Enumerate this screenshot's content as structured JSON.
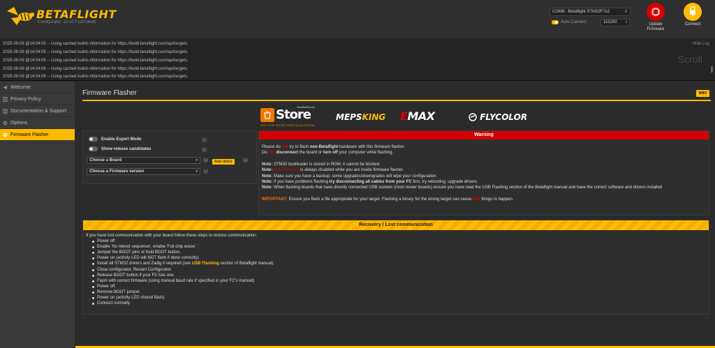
{
  "header": {
    "brand": "BETAFLIGHT",
    "version": "Configurator: 10.10.0 (c97deaf)",
    "port": "COM8 - Betaflight STM32F7x2",
    "auto_connect": "Auto-Connect",
    "baud": "115200",
    "update_firmware": "Update Firmware",
    "connect": "Connect",
    "colors": {
      "accent": "#ffbb00",
      "danger": "#d40000"
    }
  },
  "log": {
    "hide_log": "Hide Log",
    "scroll": "Scroll",
    "lines": [
      "2025-09-09 @14:04:05 -- Using cached builds information for https://build.betaflight.com/api/targets.",
      "2025-09-09 @14:04:05 -- Using cached builds information for https://build.betaflight.com/api/targets.",
      "2025-09-09 @14:04:05 -- Using cached builds information for https://build.betaflight.com/api/targets.",
      "2025-09-09 @14:04:06 -- Using cached builds information for https://build.betaflight.com/api/targets.",
      "2025-09-09 @14:04:06 -- Using cached builds information for https://build.betaflight.com/api/targets."
    ]
  },
  "sidebar": {
    "items": [
      {
        "label": "Welcome",
        "icon": "plane-icon"
      },
      {
        "label": "Privacy Policy",
        "icon": "document-icon"
      },
      {
        "label": "Documentation & Support",
        "icon": "book-icon"
      },
      {
        "label": "Options",
        "icon": "gear-icon"
      },
      {
        "label": "Firmware Flasher",
        "icon": "flash-icon"
      }
    ]
  },
  "main": {
    "title": "Firmware Flasher",
    "wiki": "WIKI",
    "sponsors": {
      "store_top": "NewBeeDrone",
      "store_word": "Store",
      "store_sub": "ONE STOP DRONE SHOP @CALIFORNIA",
      "meps_a": "MEPS",
      "meps_b": "KING",
      "emax_a": "E",
      "emax_b": "MAX",
      "flycolor": "FLYCOLOR"
    },
    "options": {
      "expert_mode": "Enable Expert Mode",
      "release_candidates": "Show release candidates",
      "choose_board": "Choose a Board",
      "auto_detect": "Auto-detect",
      "choose_firmware": "Choose a Firmware version"
    },
    "warning": {
      "title": "Warning",
      "l1a": "Please do ",
      "l1b": "not",
      "l1c": " try to flash ",
      "l1d": "non-Betaflight",
      "l1e": " hardware with this firmware flasher.",
      "l2a": "Do ",
      "l2b": "not",
      "l2c": "disconnect",
      "l2d": " the board or ",
      "l2e": "turn off",
      "l2f": " your computer while flashing.",
      "note": "Note:",
      "n1": " STM32 bootloader is stored in ROM, it cannot be bricked.",
      "n2a": "Auto-Connect",
      "n2b": " is always disabled while you are inside firmware flasher.",
      "n3": " Make sure you have a backup; some upgrades/downgrades will wipe your configuration.",
      "n4a": " If you have problems flashing ",
      "n4b": "try disconnecting all cables from your FC",
      "n4c": " first, try rebooting, upgrade drivers.",
      "n5": " When flashing boards that have directly connected USB sockets (most newer boards) ensure you have read the USB Flashing section of the Betaflight manual and have the correct software and drivers installed",
      "important": "IMPORTANT",
      "imp_a": ": Ensure you flash a file appropriate for your target. Flashing a binary for the wrong target can cause ",
      "imp_b": "bad",
      "imp_c": " things to happen."
    },
    "recovery": {
      "title": "Recovery / Lost communication",
      "intro": "If you have lost communication with your board follow these steps to restore communication:",
      "steps": [
        "Power off",
        "Enable 'No reboot sequence', enable 'Full chip erase'.",
        "Jumper the BOOT pins or hold BOOT button.",
        "Power on (activity LED will NOT flash if done correctly).",
        "Install all STM32 drivers and Zadig if required (see ",
        "Close configurator, Restart Configurator.",
        "Release BOOT button if your FC has one.",
        "Flash with correct firmware (using manual baud rate if specified in your FC's manual).",
        "Power off.",
        "Remove BOOT jumper.",
        "Power on (activity LED should flash).",
        "Connect normally."
      ],
      "usb_link": "USB Flashing",
      "usb_tail": " section of Betaflight manual)."
    }
  }
}
